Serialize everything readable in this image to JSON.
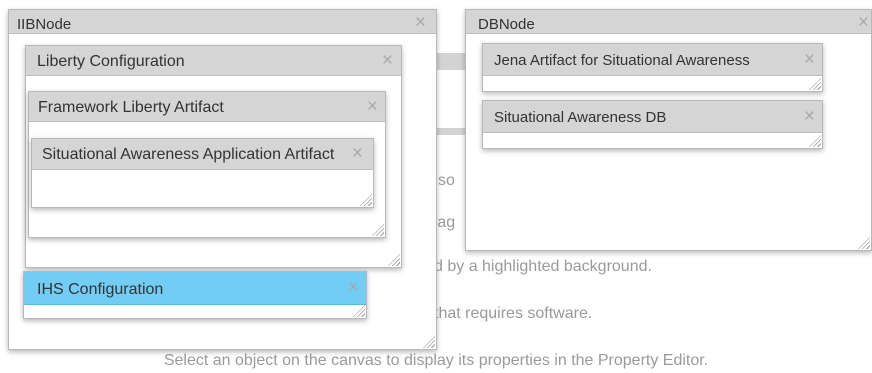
{
  "canvas_hints": {
    "line_partial_1": "so",
    "line_partial_2": "rag",
    "line_3": "d by a highlighted background.",
    "line_4": "that requires software.",
    "line_5": "Select an object on the canvas to display its properties in the Property Editor."
  },
  "nodes": {
    "iib": {
      "title": "IIBNode",
      "children": {
        "liberty": {
          "title": "Liberty Configuration",
          "children": {
            "framework": {
              "title": "Framework Liberty Artifact",
              "children": {
                "sa_app": {
                  "title": "Situational Awareness Application Artifact"
                }
              }
            }
          }
        },
        "ihs": {
          "title": "IHS Configuration"
        }
      }
    },
    "db": {
      "title": "DBNode",
      "children": {
        "jena": {
          "title": "Jena Artifact for Situational Awareness"
        },
        "sa_db": {
          "title": "Situational Awareness DB"
        }
      }
    }
  },
  "icons": {
    "close": "close-icon",
    "resize": "resize-grip-icon"
  },
  "colors": {
    "header": "#d5d5d5",
    "selected_header": "#72cdf4",
    "hint_text": "#9a9a9a"
  },
  "close_glyph": "×"
}
